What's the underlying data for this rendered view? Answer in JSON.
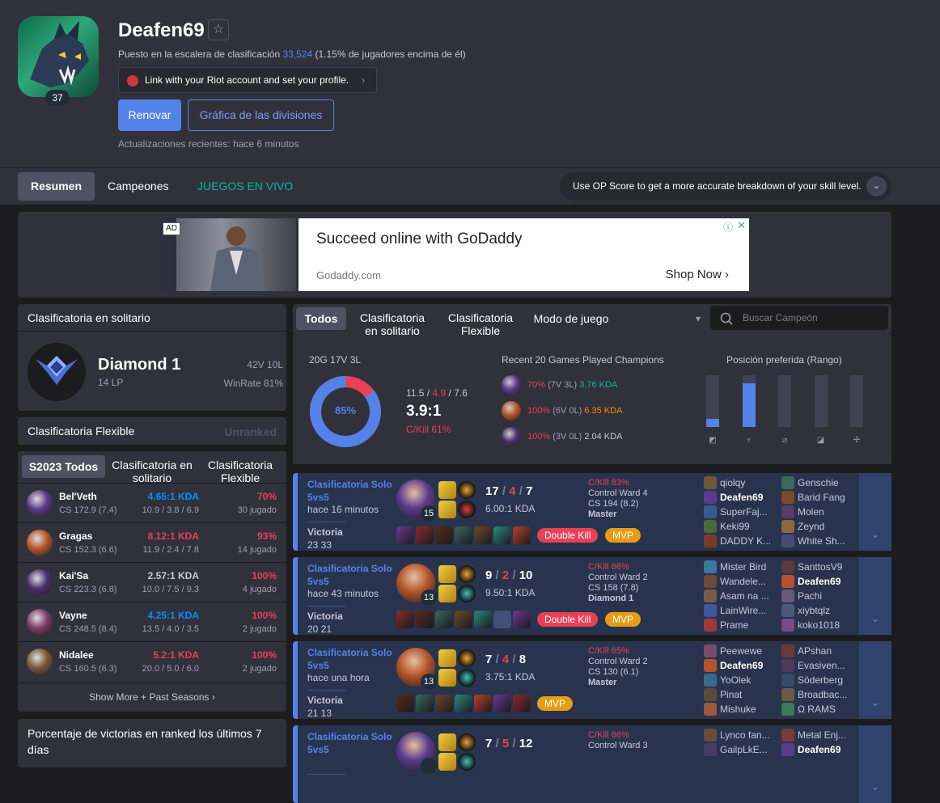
{
  "profile": {
    "name": "Deafen69",
    "level": "37",
    "star": "☆",
    "ladder_prefix": "Puesto en la escalera de clasificación ",
    "ladder_rank": "33,524",
    "ladder_suffix": " (1.15% de jugadores encima de él)",
    "riot_link": "Link with your Riot account and set your profile.",
    "riot_chevron": "›",
    "renew": "Renovar",
    "tier_graph": "Gráfica de las divisiones",
    "updated": "Actualizaciones recientes: hace 6 minutos"
  },
  "nav": {
    "summary": "Resumen",
    "champions": "Campeones",
    "live": "JUEGOS EN VIVO",
    "opscore": "Use OP Score to get a more accurate breakdown of your skill level.",
    "opscore_toggle": "⌄"
  },
  "ad": {
    "tag": "AD",
    "title": "Succeed online with GoDaddy",
    "domain": "Godaddy.com",
    "cta": "Shop Now ›",
    "info": "ⓘ",
    "close": "✕"
  },
  "solo": {
    "title": "Clasificatoria en solitario",
    "tier": "Diamond 1",
    "lp": "14 LP",
    "wl": "42V 10L",
    "winrate": "WinRate 81%"
  },
  "flex": {
    "title": "Clasificatoria Flexible",
    "status": "Unranked"
  },
  "champ_tabs": {
    "all": "S2023 Todos",
    "solo": "Clasificatoria en solitario",
    "flex": "Clasificatoria Flexible"
  },
  "champions": [
    {
      "name": "Bel'Veth",
      "cs": "CS 172.9 (7.4)",
      "kda": "4.65:1 KDA",
      "avg": "10.9 / 3.8 / 6.9",
      "wr": "70%",
      "games": "30 jugado",
      "kda_color": "#0093ff",
      "icon_color": "#5b3b8c"
    },
    {
      "name": "Gragas",
      "cs": "CS 152.3 (6.6)",
      "kda": "8.12:1 KDA",
      "avg": "11.9 / 2.4 / 7.8",
      "wr": "93%",
      "games": "14 jugado",
      "kda_color": "#e84057",
      "icon_color": "#b4532a"
    },
    {
      "name": "Kai'Sa",
      "cs": "CS 223.3 (6.8)",
      "kda": "2.57:1 KDA",
      "avg": "10.0 / 7.5 / 9.3",
      "wr": "100%",
      "games": "4 jugado",
      "kda_color": "#c8c8d6",
      "icon_color": "#4b2f6e"
    },
    {
      "name": "Vayne",
      "cs": "CS 248.5 (8.4)",
      "kda": "4.25:1 KDA",
      "avg": "13.5 / 4.0 / 3.5",
      "wr": "100%",
      "games": "2 jugado",
      "kda_color": "#0093ff",
      "icon_color": "#7a3e66"
    },
    {
      "name": "Nidalee",
      "cs": "CS 160.5 (6.3)",
      "kda": "5.2:1 KDA",
      "avg": "20.0 / 5.0 / 6.0",
      "wr": "100%",
      "games": "2 jugado",
      "kda_color": "#e84057",
      "icon_color": "#7a5836"
    }
  ],
  "show_more": "Show More + Past Seasons ›",
  "wr7": {
    "title": "Porcentaje de victorias en ranked los últimos 7 días"
  },
  "filters": {
    "all": "Todos",
    "solo": "Clasificatoria en solitario",
    "flex": "Clasificatoria Flexible",
    "mode": "Modo de juego",
    "mode_caret": "▾",
    "search_placeholder": "Buscar Campeón"
  },
  "summary": {
    "record": "20G 17V 3L",
    "winrate_pct": 85,
    "winrate_label": "85%",
    "kills": "11.5",
    "deaths": "4.9",
    "assists": "7.6",
    "sep": " / ",
    "ratio": "3.9:1",
    "kp": "C/Kill 61%",
    "recent_title": "Recent 20 Games Played Champions",
    "recent": [
      {
        "wr": "70%",
        "wl": " (7V 3L) ",
        "kda": "3.76 KDA",
        "kda_color": "#00bba3",
        "icon_color": "#5b3b8c"
      },
      {
        "wr": "100%",
        "wl": " (6V 0L) ",
        "kda": "6.35 KDA",
        "kda_color": "#ff8200",
        "icon_color": "#b4532a"
      },
      {
        "wr": "100%",
        "wl": " (3V 0L) ",
        "kda": "2.04 KDA",
        "kda_color": "#c8c8d6",
        "icon_color": "#4b2f6e"
      }
    ],
    "position_title": "Posición preferida (Rango)",
    "positions": [
      {
        "role": "top-icon",
        "glyph": "◩",
        "share": 0.15
      },
      {
        "role": "jungle-icon",
        "glyph": "♆",
        "share": 0.85
      },
      {
        "role": "mid-icon",
        "glyph": "⧄",
        "share": 0
      },
      {
        "role": "adc-icon",
        "glyph": "◪",
        "share": 0
      },
      {
        "role": "support-icon",
        "glyph": "✢",
        "share": 0
      }
    ]
  },
  "games": [
    {
      "type": "Clasificatoria Solo 5vs5",
      "time": "hace 16 minutos",
      "result": "Victoria",
      "duration": "23 33",
      "level": "15",
      "k": "17",
      "d": "4",
      "a": "7",
      "ratio": "6.00:1 KDA",
      "kp": "C/Kill 83%",
      "ward": "Control Ward 4",
      "cs": "CS 194 (8.2)",
      "rank": "Master",
      "badges": [
        "Double Kill",
        "MVP"
      ],
      "champ_color": "#5b3b8c",
      "team1": [
        "qiolqy",
        "Deafen69",
        "SuperFaj...",
        "Keki99",
        "DADDY K..."
      ],
      "team2": [
        "Genschie",
        "Barid Fang",
        "Molen",
        "Zeynd",
        "White Sh..."
      ],
      "t1c": [
        "#6b5a3a",
        "#5b3b8c",
        "#3a5a8c",
        "#4a6a3a",
        "#7a3a2a"
      ],
      "t2c": [
        "#3a6a5a",
        "#7a4a2a",
        "#5a3a6a",
        "#8a6a3a",
        "#4a4a7a"
      ]
    },
    {
      "type": "Clasificatoria Solo 5vs5",
      "time": "hace 43 minutos",
      "result": "Victoria",
      "duration": "20 21",
      "level": "13",
      "k": "9",
      "d": "2",
      "a": "10",
      "ratio": "9.50:1 KDA",
      "kp": "C/Kill 66%",
      "ward": "Control Ward 2",
      "cs": "CS 158 (7.8)",
      "rank": "Diamond 1",
      "badges": [
        "Double Kill",
        "MVP"
      ],
      "champ_color": "#b4532a",
      "team1": [
        "Mister Bird",
        "Wandele...",
        "Asam na ...",
        "LainWire...",
        "Prame"
      ],
      "team2": [
        "SanttosV9",
        "Deafen69",
        "Pachi",
        "xiybtqlz",
        "koko1018"
      ],
      "t1c": [
        "#3a7a9c",
        "#6a4a3a",
        "#7a5a4a",
        "#3a5a9c",
        "#9c3a3a"
      ],
      "t2c": [
        "#5a3a3a",
        "#b4532a",
        "#6a5a7a",
        "#4a5a7a",
        "#7a4a8a"
      ]
    },
    {
      "type": "Clasificatoria Solo 5vs5",
      "time": "hace una hora",
      "result": "Victoria",
      "duration": "21 13",
      "level": "13",
      "k": "7",
      "d": "4",
      "a": "8",
      "ratio": "3.75:1 KDA",
      "kp": "C/Kill 65%",
      "ward": "Control Ward 2",
      "cs": "CS 130 (6.1)",
      "rank": "Master",
      "badges": [
        "MVP"
      ],
      "champ_color": "#b4532a",
      "team1": [
        "Peewewe",
        "Deafen69",
        "YoOlek",
        "Pinat",
        "Mishuke"
      ],
      "team2": [
        "APshan",
        "Evasiven...",
        "Söderberg",
        "Broadbac...",
        "Ω RAMS"
      ],
      "t1c": [
        "#7a4a6a",
        "#b4532a",
        "#3a6a8a",
        "#5a4a3a",
        "#9c5a3a"
      ],
      "t2c": [
        "#6a3a3a",
        "#4a3a5a",
        "#3a4a6a",
        "#6a5a4a",
        "#3a7a5a"
      ]
    },
    {
      "type": "Clasificatoria Solo 5vs5",
      "time": "",
      "result": "",
      "duration": "",
      "level": "",
      "k": "7",
      "d": "5",
      "a": "12",
      "ratio": "",
      "kp": "C/Kill 66%",
      "ward": "Control Ward 3",
      "cs": "",
      "rank": "",
      "badges": [],
      "champ_color": "#5b3b8c",
      "team1": [
        "Lynco fan...",
        "GailpLkE..."
      ],
      "team2": [
        "Metal Enj...",
        "Deafen69"
      ],
      "t1c": [
        "#6a4a3a",
        "#4a3a6a"
      ],
      "t2c": [
        "#7a3a3a",
        "#5b3b8c"
      ]
    }
  ],
  "colors": {
    "accent": "#5383e8",
    "win_bg": "#28344e",
    "loss_red": "#e84057",
    "teal": "#00bba3"
  }
}
